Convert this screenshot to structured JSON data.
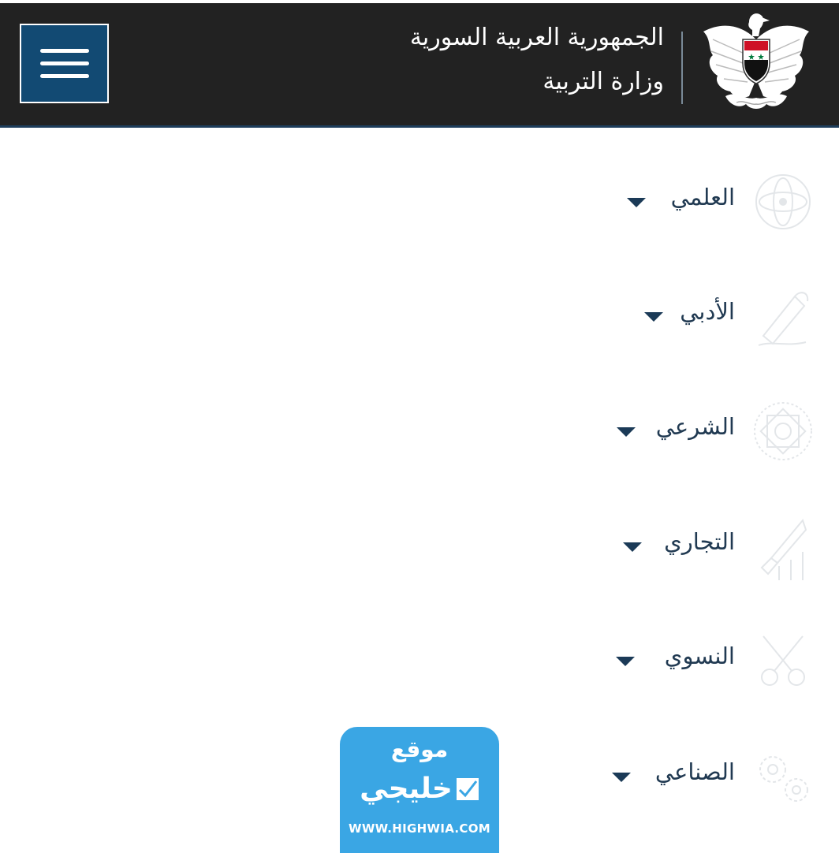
{
  "header": {
    "title": "الجمهورية العربية السورية",
    "subtitle": "وزارة التربية",
    "menu_icon": "hamburger-icon",
    "emblem_icon": "syrian-eagle-emblem",
    "colors": {
      "bar": "#222222",
      "menu_button": "#124a73"
    }
  },
  "branches": [
    {
      "label": "العلمي",
      "icon": "science-icon"
    },
    {
      "label": "الأدبي",
      "icon": "literature-icon"
    },
    {
      "label": "الشرعي",
      "icon": "religious-pattern-icon"
    },
    {
      "label": "التجاري",
      "icon": "commerce-rocket-icon"
    },
    {
      "label": "النسوي",
      "icon": "sewing-icon"
    },
    {
      "label": "الصناعي",
      "icon": "gears-icon"
    }
  ],
  "watermark": {
    "line1": "موقع",
    "line2": "خليجي",
    "url": "WWW.HIGHWIA.COM",
    "color": "#3aa6e4"
  },
  "colors": {
    "label_text": "#213a52",
    "caret": "#1b3a57"
  }
}
